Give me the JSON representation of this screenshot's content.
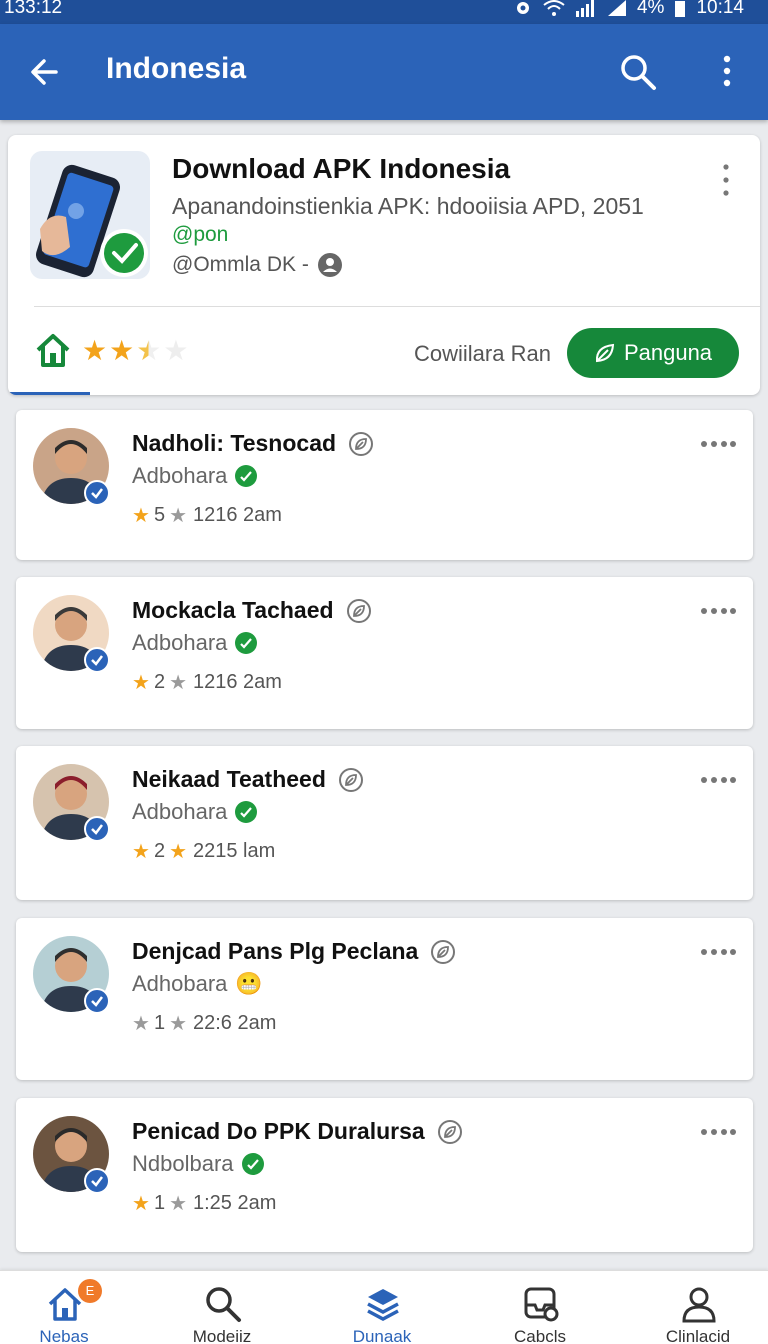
{
  "status_bar": {
    "time_left": "133:12",
    "battery": "4%",
    "time_right": "10:14"
  },
  "app_bar": {
    "title": "Indonesia"
  },
  "featured": {
    "title": "Download APK Indonesia",
    "subtitle": "Apanandoinstienkia APK: hdooiisia APD, 2051",
    "tag": "@pon",
    "developer": "@Ommla DK -",
    "rating": 2.5,
    "label": "Cowiilara Ran",
    "install_label": "Panguna"
  },
  "reviews": [
    {
      "name": "Nadholi: Tesnocad",
      "sub": "Adbohara",
      "score": "5",
      "time": "1216 2am",
      "lead_star": "gold"
    },
    {
      "name": "Mockacla Tachaed",
      "sub": "Adbohara",
      "score": "2",
      "time": "1216 2am",
      "lead_star": "gold"
    },
    {
      "name": "Neikaad Teatheed",
      "sub": "Adbohara",
      "score": "2",
      "time": "2215 lam",
      "lead_star": "gold"
    },
    {
      "name": "Denjcad Pans Plg Peclana",
      "sub": "Adhobara",
      "score": "1",
      "time": "22:6 2am",
      "lead_star": "gray"
    },
    {
      "name": "Penicad Do PPK Duralursa",
      "sub": "Ndbolbara",
      "score": "1",
      "time": "1:25 2am",
      "lead_star": "gold"
    }
  ],
  "bottom_nav": [
    {
      "label": "Nebas",
      "icon": "home-icon",
      "badge": "E"
    },
    {
      "label": "Modeiiz",
      "icon": "search-icon"
    },
    {
      "label": "Dunaak",
      "icon": "layers-icon"
    },
    {
      "label": "Cabcls",
      "icon": "inbox-icon"
    },
    {
      "label": "Clinlacid",
      "icon": "profile-icon"
    }
  ],
  "colors": {
    "primary": "#2b63b8",
    "status_bar": "#1f4f99",
    "accent_green": "#16883a",
    "star": "#f3a31b"
  }
}
